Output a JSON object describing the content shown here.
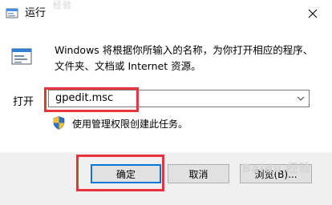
{
  "window": {
    "title": "运行",
    "ghost_title": "经验",
    "icons": {
      "app": "run-app-icon",
      "close": "close-icon"
    }
  },
  "dialog": {
    "description": "Windows 将根据你所输入的名称，为你打开相应的程序、文件夹、文档或 Internet 资源。",
    "open_label": "打开",
    "command_value": "gpedit.msc",
    "admin_note": "使用管理权限创建此任务。",
    "icons": {
      "run": "run-icon",
      "dropdown": "chevron-down-icon",
      "shield": "uac-shield-icon"
    }
  },
  "buttons": {
    "ok": "确定",
    "cancel": "取消",
    "browse": "浏览(B)..."
  },
  "watermark": "Baidu 经验",
  "colors": {
    "highlight": "#e7333a",
    "focus": "#0078d7",
    "footer_bg": "#f0f0f0",
    "button_bg": "#e1e1e1"
  }
}
